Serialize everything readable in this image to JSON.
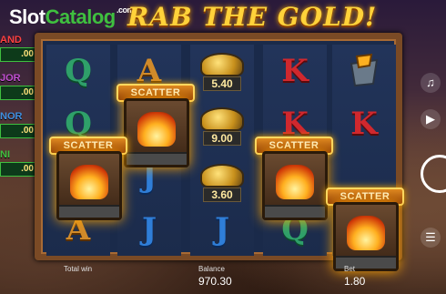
{
  "watermark": {
    "slot": "Slot",
    "catalog": "Catalog",
    "com": ".com"
  },
  "game": {
    "title_part": "RAB THE GOLD!",
    "small_prefix": ""
  },
  "jackpots": [
    {
      "name": "AND",
      "amount": ".00"
    },
    {
      "name": "JOR",
      "amount": ".00"
    },
    {
      "name": "NOR",
      "amount": ".00"
    },
    {
      "name": "NI",
      "amount": ".00"
    }
  ],
  "reels": [
    {
      "symbols": [
        "Q",
        "Q",
        "",
        "A"
      ]
    },
    {
      "symbols": [
        "A",
        "",
        "J",
        "J"
      ]
    },
    {
      "symbols": [
        "5.40",
        "9.00",
        "3.60",
        "J"
      ]
    },
    {
      "symbols": [
        "K",
        "K",
        "",
        "Q"
      ]
    },
    {
      "symbols": [
        "",
        "K",
        "",
        ""
      ]
    }
  ],
  "gold_values": [
    "5.40",
    "9.00",
    "3.60"
  ],
  "scatter_label": "SCATTER",
  "bottom": {
    "total_win_label": "Total win",
    "balance_label": "Balance",
    "balance_value": "970.30",
    "bet_label": "Bet",
    "bet_value": "1.80"
  },
  "icons": {
    "volume": "volume-icon",
    "menu": "menu-icon",
    "spin": "spin-icon"
  }
}
